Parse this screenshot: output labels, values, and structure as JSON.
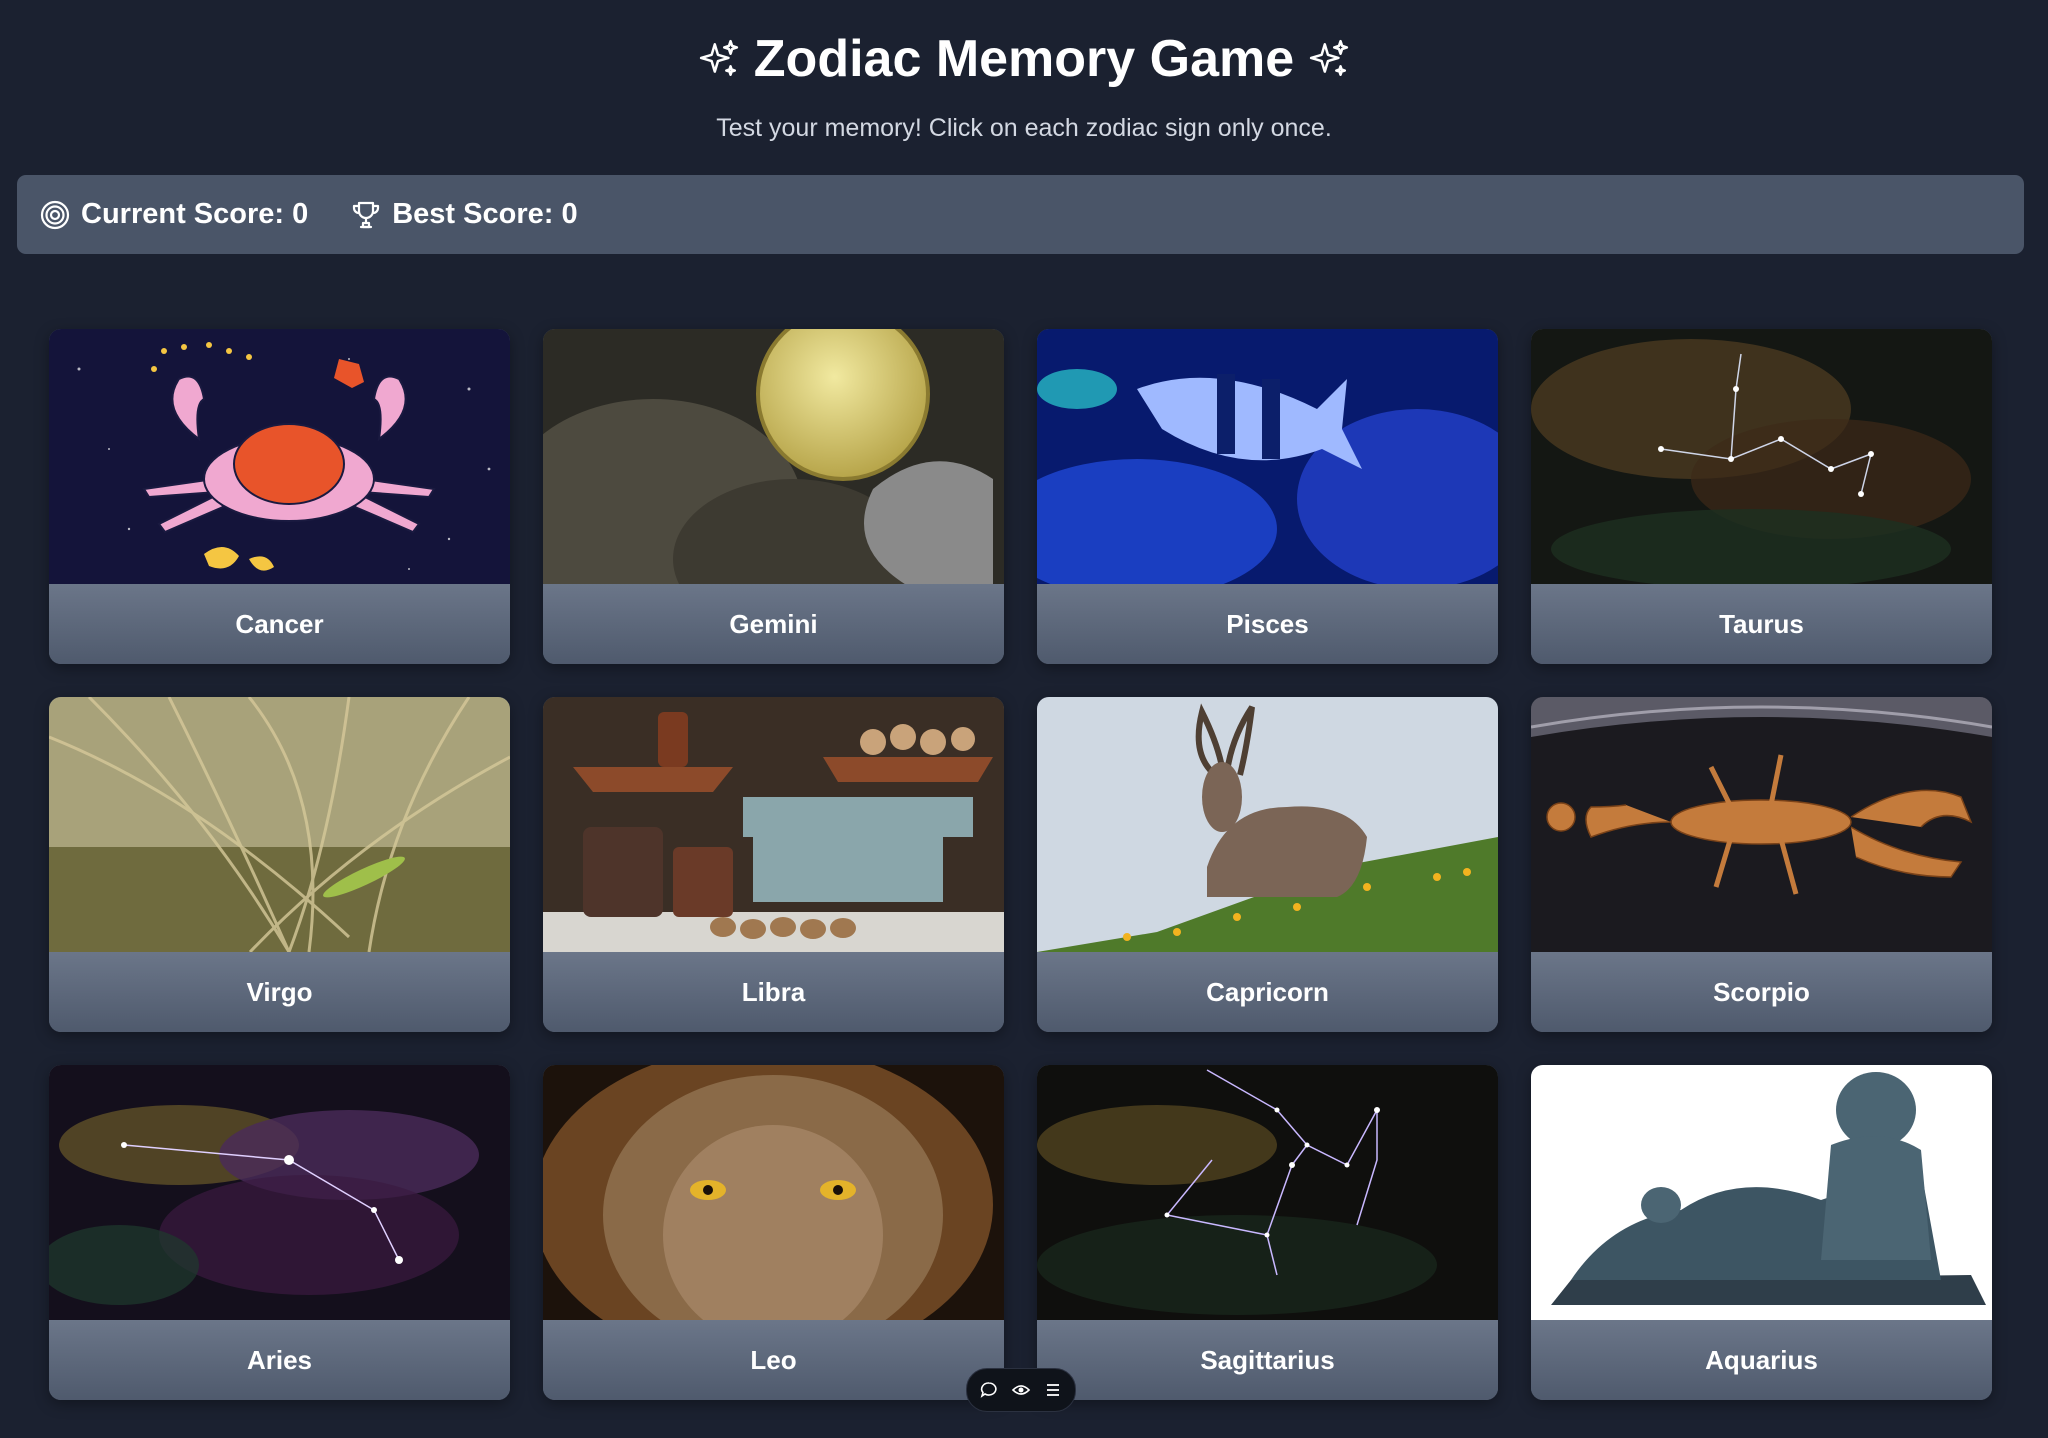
{
  "header": {
    "title": "Zodiac Memory Game",
    "subtitle": "Test your memory! Click on each zodiac sign only once."
  },
  "scoreboard": {
    "current_label": "Current Score: 0",
    "best_label": "Best Score: 0"
  },
  "cards": [
    {
      "label": "Cancer"
    },
    {
      "label": "Gemini"
    },
    {
      "label": "Pisces"
    },
    {
      "label": "Taurus"
    },
    {
      "label": "Virgo"
    },
    {
      "label": "Libra"
    },
    {
      "label": "Capricorn"
    },
    {
      "label": "Scorpio"
    },
    {
      "label": "Aries"
    },
    {
      "label": "Leo"
    },
    {
      "label": "Sagittarius"
    },
    {
      "label": "Aquarius"
    }
  ],
  "colors": {
    "background": "#1b2130",
    "scorebar": "#4a5568",
    "card_label": "#5e6a7f"
  },
  "icons": {
    "title_left": "sparkles-icon",
    "title_right": "sparkles-icon",
    "current_score": "target-icon",
    "best_score": "trophy-icon",
    "toolbar": [
      "chat-icon",
      "eye-icon",
      "menu-icon"
    ]
  }
}
